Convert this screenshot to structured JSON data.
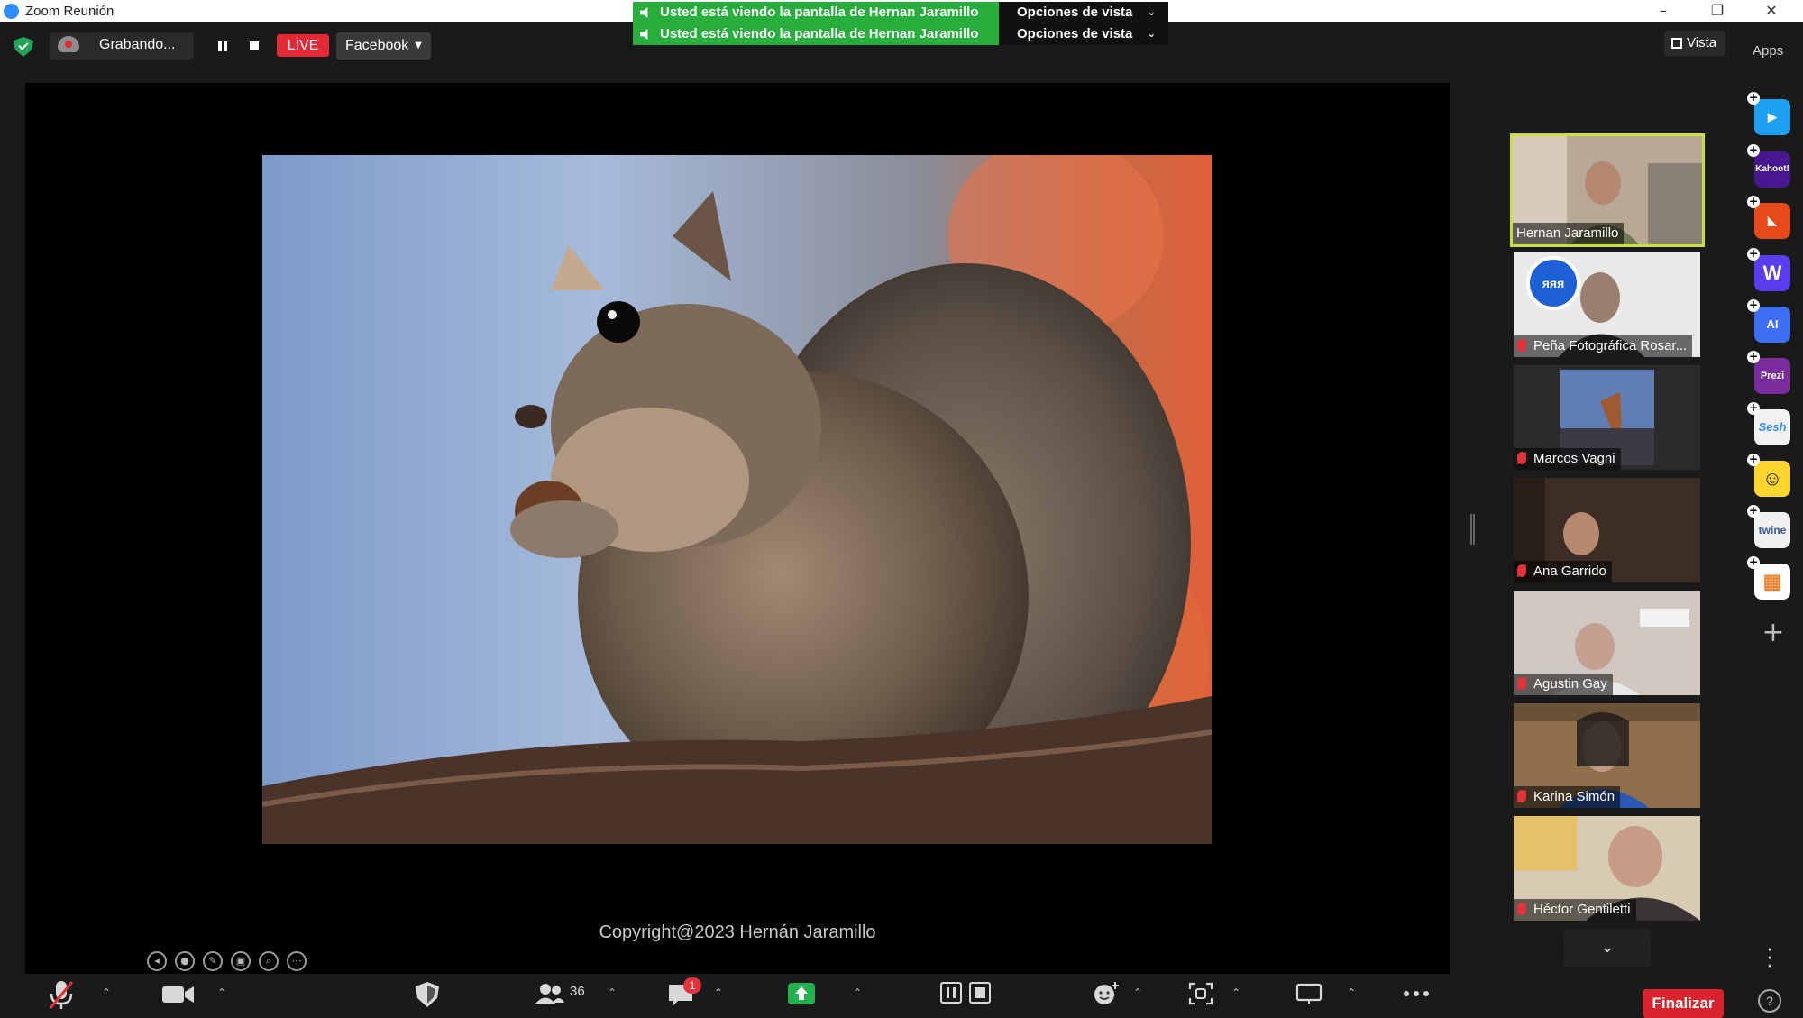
{
  "window": {
    "title": "Zoom Reunión",
    "controls": [
      "–",
      "❐",
      "✕"
    ]
  },
  "share_banners": [
    {
      "text": "Usted está viendo la pantalla de Hernan Jaramillo",
      "options_label": "Opciones de vista"
    },
    {
      "text": "Usted está viendo la pantalla de Hernan Jaramillo",
      "options_label": "Opciones de vista"
    }
  ],
  "meeting_bar": {
    "recording_label": "Grabando...",
    "live_label": "LIVE",
    "stream_target": "Facebook",
    "view_label": "Vista",
    "apps_label": "Apps"
  },
  "shared_screen": {
    "copyright": "Copyright@2023 Hernán Jaramillo",
    "annotation_tools": [
      "◂",
      "●",
      "✎",
      "▣",
      "⌕",
      "⋯"
    ]
  },
  "participants": [
    {
      "name": "Hernan Jaramillo",
      "muted": false,
      "active_speaker": true
    },
    {
      "name": "Peña Fotográfica Rosar...",
      "muted": true,
      "active_speaker": false,
      "overlay_text": "ᴙᴙᴙ"
    },
    {
      "name": "Marcos Vagni",
      "muted": true,
      "active_speaker": false
    },
    {
      "name": "Ana Garrido",
      "muted": true,
      "active_speaker": false
    },
    {
      "name": "Agustin Gay",
      "muted": true,
      "active_speaker": false
    },
    {
      "name": "Karina Simón",
      "muted": true,
      "active_speaker": false
    },
    {
      "name": "Héctor Gentiletti",
      "muted": true,
      "active_speaker": false
    }
  ],
  "apps": [
    {
      "icon": "flip-app-icon",
      "label": "▶",
      "color": "#1da1f2"
    },
    {
      "icon": "kahoot-icon",
      "label": "Kahoot!",
      "color": "#46178f"
    },
    {
      "icon": "red-app-icon",
      "label": "◣",
      "color": "#e64a19"
    },
    {
      "icon": "wooclap-icon",
      "label": "W",
      "color": "#5b3cf0"
    },
    {
      "icon": "ai-app-icon",
      "label": "AI",
      "color": "#3d6ef5"
    },
    {
      "icon": "prezi-icon",
      "label": "Prezi",
      "color": "#7a2b9c"
    },
    {
      "icon": "sesh-icon",
      "label": "Sesh",
      "color": "#f2f2f2"
    },
    {
      "icon": "emoji-app-icon",
      "label": "☺",
      "color": "#ffd52e"
    },
    {
      "icon": "twine-icon",
      "label": "twine",
      "color": "#f0f0f0"
    },
    {
      "icon": "blocks-app-icon",
      "label": "▦",
      "color": "#ffffff"
    }
  ],
  "toolbar": {
    "participants_count": "36",
    "chat_badge": "1",
    "end_label": "Finalizar",
    "help_label": "?"
  }
}
